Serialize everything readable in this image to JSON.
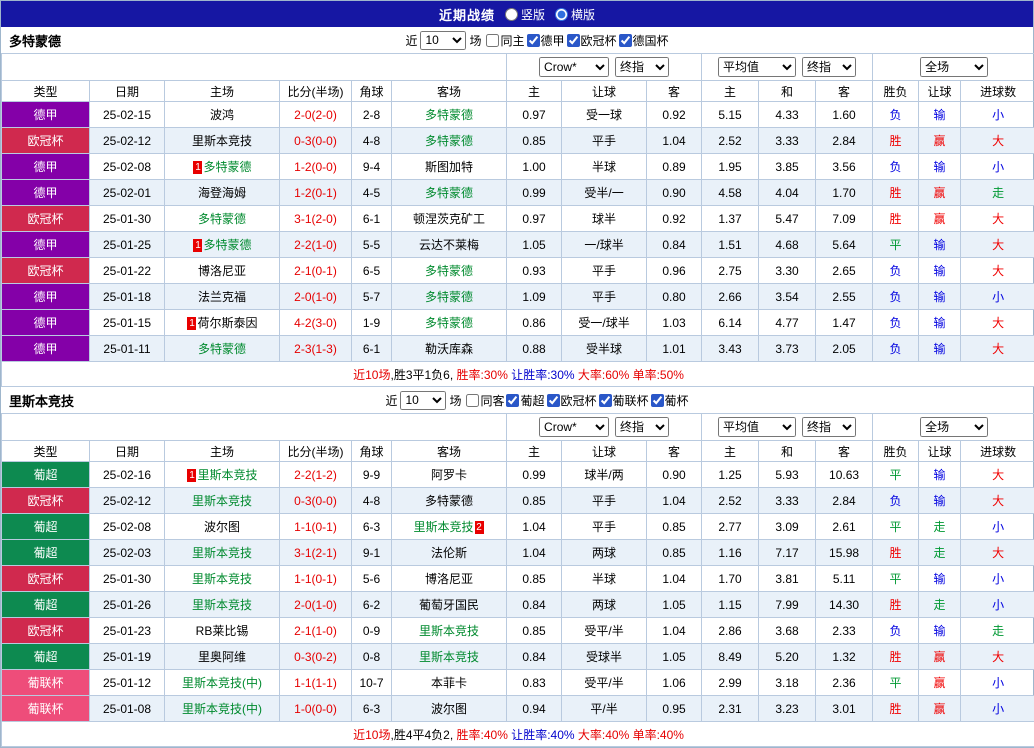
{
  "topbar": {
    "title": "近期战绩",
    "layout_options": [
      {
        "label": "竖版",
        "selected": false
      },
      {
        "label": "横版",
        "selected": true
      }
    ]
  },
  "table_head": {
    "selects": {
      "bookmaker": "Crow*",
      "ah_final": "终指",
      "eu_avg": "平均值",
      "eu_final": "终指",
      "scope": "全场"
    },
    "labels": [
      "类型",
      "日期",
      "主场",
      "比分(半场)",
      "角球",
      "客场",
      "主",
      "让球",
      "客",
      "主",
      "和",
      "客",
      "胜负",
      "让球",
      "进球数"
    ]
  },
  "league_colors": {
    "德甲": "#8400a8",
    "欧冠杯": "#d0294e",
    "葡超": "#0d8a50",
    "葡联杯": "#ee4d7a"
  },
  "sections": [
    {
      "team": "多特蒙德",
      "filter": {
        "near": "近",
        "count": "10",
        "unit": "场",
        "checkboxes": [
          {
            "label": "同主",
            "checked": false
          },
          {
            "label": "德甲",
            "checked": true
          },
          {
            "label": "欧冠杯",
            "checked": true
          },
          {
            "label": "德国杯",
            "checked": true
          }
        ]
      },
      "rows": [
        {
          "league": "德甲",
          "date": "25-02-15",
          "home": {
            "name": "波鸿"
          },
          "score": "2-0(2-0)",
          "corners": "2-8",
          "away": {
            "name": "多特蒙德",
            "tracked": true
          },
          "ah": [
            "0.97",
            "受一球",
            "0.92"
          ],
          "eu": [
            "5.15",
            "4.33",
            "1.60"
          ],
          "results": [
            [
              "负",
              "l"
            ],
            [
              "输",
              "l"
            ],
            [
              "小",
              "l"
            ]
          ]
        },
        {
          "league": "欧冠杯",
          "date": "25-02-12",
          "home": {
            "name": "里斯本竞技"
          },
          "score": "0-3(0-0)",
          "corners": "4-8",
          "away": {
            "name": "多特蒙德",
            "tracked": true
          },
          "ah": [
            "0.85",
            "平手",
            "1.04"
          ],
          "eu": [
            "2.52",
            "3.33",
            "2.84"
          ],
          "results": [
            [
              "胜",
              "w"
            ],
            [
              "赢",
              "w"
            ],
            [
              "大",
              "w"
            ]
          ]
        },
        {
          "league": "德甲",
          "date": "25-02-08",
          "home": {
            "name": "多特蒙德",
            "tracked": true,
            "badge": "1"
          },
          "score": "1-2(0-0)",
          "corners": "9-4",
          "away": {
            "name": "斯图加特"
          },
          "ah": [
            "1.00",
            "半球",
            "0.89"
          ],
          "eu": [
            "1.95",
            "3.85",
            "3.56"
          ],
          "results": [
            [
              "负",
              "l"
            ],
            [
              "输",
              "l"
            ],
            [
              "小",
              "l"
            ]
          ]
        },
        {
          "league": "德甲",
          "date": "25-02-01",
          "home": {
            "name": "海登海姆"
          },
          "score": "1-2(0-1)",
          "corners": "4-5",
          "away": {
            "name": "多特蒙德",
            "tracked": true
          },
          "ah": [
            "0.99",
            "受半/一",
            "0.90"
          ],
          "eu": [
            "4.58",
            "4.04",
            "1.70"
          ],
          "results": [
            [
              "胜",
              "w"
            ],
            [
              "赢",
              "w"
            ],
            [
              "走",
              "d"
            ]
          ]
        },
        {
          "league": "欧冠杯",
          "date": "25-01-30",
          "home": {
            "name": "多特蒙德",
            "tracked": true
          },
          "score": "3-1(2-0)",
          "corners": "6-1",
          "away": {
            "name": "顿涅茨克矿工"
          },
          "ah": [
            "0.97",
            "球半",
            "0.92"
          ],
          "eu": [
            "1.37",
            "5.47",
            "7.09"
          ],
          "results": [
            [
              "胜",
              "w"
            ],
            [
              "赢",
              "w"
            ],
            [
              "大",
              "w"
            ]
          ]
        },
        {
          "league": "德甲",
          "date": "25-01-25",
          "home": {
            "name": "多特蒙德",
            "tracked": true,
            "badge": "1"
          },
          "score": "2-2(1-0)",
          "corners": "5-5",
          "away": {
            "name": "云达不莱梅"
          },
          "ah": [
            "1.05",
            "一/球半",
            "0.84"
          ],
          "eu": [
            "1.51",
            "4.68",
            "5.64"
          ],
          "results": [
            [
              "平",
              "d"
            ],
            [
              "输",
              "l"
            ],
            [
              "大",
              "w"
            ]
          ]
        },
        {
          "league": "欧冠杯",
          "date": "25-01-22",
          "home": {
            "name": "博洛尼亚"
          },
          "score": "2-1(0-1)",
          "corners": "6-5",
          "away": {
            "name": "多特蒙德",
            "tracked": true
          },
          "ah": [
            "0.93",
            "平手",
            "0.96"
          ],
          "eu": [
            "2.75",
            "3.30",
            "2.65"
          ],
          "results": [
            [
              "负",
              "l"
            ],
            [
              "输",
              "l"
            ],
            [
              "大",
              "w"
            ]
          ]
        },
        {
          "league": "德甲",
          "date": "25-01-18",
          "home": {
            "name": "法兰克福"
          },
          "score": "2-0(1-0)",
          "corners": "5-7",
          "away": {
            "name": "多特蒙德",
            "tracked": true
          },
          "ah": [
            "1.09",
            "平手",
            "0.80"
          ],
          "eu": [
            "2.66",
            "3.54",
            "2.55"
          ],
          "results": [
            [
              "负",
              "l"
            ],
            [
              "输",
              "l"
            ],
            [
              "小",
              "l"
            ]
          ]
        },
        {
          "league": "德甲",
          "date": "25-01-15",
          "home": {
            "name": "荷尔斯泰因",
            "badge": "1"
          },
          "score": "4-2(3-0)",
          "corners": "1-9",
          "away": {
            "name": "多特蒙德",
            "tracked": true
          },
          "ah": [
            "0.86",
            "受一/球半",
            "1.03"
          ],
          "eu": [
            "6.14",
            "4.77",
            "1.47"
          ],
          "results": [
            [
              "负",
              "l"
            ],
            [
              "输",
              "l"
            ],
            [
              "大",
              "w"
            ]
          ]
        },
        {
          "league": "德甲",
          "date": "25-01-11",
          "home": {
            "name": "多特蒙德",
            "tracked": true
          },
          "score": "2-3(1-3)",
          "corners": "6-1",
          "away": {
            "name": "勒沃库森"
          },
          "ah": [
            "0.88",
            "受半球",
            "1.01"
          ],
          "eu": [
            "3.43",
            "3.73",
            "2.05"
          ],
          "results": [
            [
              "负",
              "l"
            ],
            [
              "输",
              "l"
            ],
            [
              "大",
              "w"
            ]
          ]
        }
      ],
      "summary": [
        {
          "text": "近10场",
          "cls": "red"
        },
        {
          "text": ",胜3平1负6, ",
          "cls": "black"
        },
        {
          "text": "胜率:30%",
          "cls": "red"
        },
        {
          "text": " 让胜率:30%",
          "cls": "blue"
        },
        {
          "text": " 大率:60%",
          "cls": "red"
        },
        {
          "text": " 单率:50%",
          "cls": "red"
        }
      ]
    },
    {
      "team": "里斯本竞技",
      "filter": {
        "near": "近",
        "count": "10",
        "unit": "场",
        "checkboxes": [
          {
            "label": "同客",
            "checked": false
          },
          {
            "label": "葡超",
            "checked": true
          },
          {
            "label": "欧冠杯",
            "checked": true
          },
          {
            "label": "葡联杯",
            "checked": true
          },
          {
            "label": "葡杯",
            "checked": true
          }
        ]
      },
      "rows": [
        {
          "league": "葡超",
          "date": "25-02-16",
          "home": {
            "name": "里斯本竞技",
            "tracked": true,
            "badge": "1"
          },
          "score": "2-2(1-2)",
          "corners": "9-9",
          "away": {
            "name": "阿罗卡"
          },
          "ah": [
            "0.99",
            "球半/两",
            "0.90"
          ],
          "eu": [
            "1.25",
            "5.93",
            "10.63"
          ],
          "results": [
            [
              "平",
              "d"
            ],
            [
              "输",
              "l"
            ],
            [
              "大",
              "w"
            ]
          ]
        },
        {
          "league": "欧冠杯",
          "date": "25-02-12",
          "home": {
            "name": "里斯本竞技",
            "tracked": true
          },
          "score": "0-3(0-0)",
          "corners": "4-8",
          "away": {
            "name": "多特蒙德"
          },
          "ah": [
            "0.85",
            "平手",
            "1.04"
          ],
          "eu": [
            "2.52",
            "3.33",
            "2.84"
          ],
          "results": [
            [
              "负",
              "l"
            ],
            [
              "输",
              "l"
            ],
            [
              "大",
              "w"
            ]
          ]
        },
        {
          "league": "葡超",
          "date": "25-02-08",
          "home": {
            "name": "波尔图"
          },
          "score": "1-1(0-1)",
          "corners": "6-3",
          "away": {
            "name": "里斯本竞技",
            "tracked": true,
            "badge": "2"
          },
          "ah": [
            "1.04",
            "平手",
            "0.85"
          ],
          "eu": [
            "2.77",
            "3.09",
            "2.61"
          ],
          "results": [
            [
              "平",
              "d"
            ],
            [
              "走",
              "d"
            ],
            [
              "小",
              "l"
            ]
          ]
        },
        {
          "league": "葡超",
          "date": "25-02-03",
          "home": {
            "name": "里斯本竞技",
            "tracked": true
          },
          "score": "3-1(2-1)",
          "corners": "9-1",
          "away": {
            "name": "法伦斯"
          },
          "ah": [
            "1.04",
            "两球",
            "0.85"
          ],
          "eu": [
            "1.16",
            "7.17",
            "15.98"
          ],
          "results": [
            [
              "胜",
              "w"
            ],
            [
              "走",
              "d"
            ],
            [
              "大",
              "w"
            ]
          ]
        },
        {
          "league": "欧冠杯",
          "date": "25-01-30",
          "home": {
            "name": "里斯本竞技",
            "tracked": true
          },
          "score": "1-1(0-1)",
          "corners": "5-6",
          "away": {
            "name": "博洛尼亚"
          },
          "ah": [
            "0.85",
            "半球",
            "1.04"
          ],
          "eu": [
            "1.70",
            "3.81",
            "5.11"
          ],
          "results": [
            [
              "平",
              "d"
            ],
            [
              "输",
              "l"
            ],
            [
              "小",
              "l"
            ]
          ]
        },
        {
          "league": "葡超",
          "date": "25-01-26",
          "home": {
            "name": "里斯本竞技",
            "tracked": true
          },
          "score": "2-0(1-0)",
          "corners": "6-2",
          "away": {
            "name": "葡萄牙国民"
          },
          "ah": [
            "0.84",
            "两球",
            "1.05"
          ],
          "eu": [
            "1.15",
            "7.99",
            "14.30"
          ],
          "results": [
            [
              "胜",
              "w"
            ],
            [
              "走",
              "d"
            ],
            [
              "小",
              "l"
            ]
          ]
        },
        {
          "league": "欧冠杯",
          "date": "25-01-23",
          "home": {
            "name": "RB莱比锡"
          },
          "score": "2-1(1-0)",
          "corners": "0-9",
          "away": {
            "name": "里斯本竞技",
            "tracked": true
          },
          "ah": [
            "0.85",
            "受平/半",
            "1.04"
          ],
          "eu": [
            "2.86",
            "3.68",
            "2.33"
          ],
          "results": [
            [
              "负",
              "l"
            ],
            [
              "输",
              "l"
            ],
            [
              "走",
              "d"
            ]
          ]
        },
        {
          "league": "葡超",
          "date": "25-01-19",
          "home": {
            "name": "里奥阿维"
          },
          "score": "0-3(0-2)",
          "corners": "0-8",
          "away": {
            "name": "里斯本竞技",
            "tracked": true
          },
          "ah": [
            "0.84",
            "受球半",
            "1.05"
          ],
          "eu": [
            "8.49",
            "5.20",
            "1.32"
          ],
          "results": [
            [
              "胜",
              "w"
            ],
            [
              "赢",
              "w"
            ],
            [
              "大",
              "w"
            ]
          ]
        },
        {
          "league": "葡联杯",
          "date": "25-01-12",
          "home": {
            "name": "里斯本竞技(中)",
            "tracked": true
          },
          "score": "1-1(1-1)",
          "corners": "10-7",
          "away": {
            "name": "本菲卡"
          },
          "ah": [
            "0.83",
            "受平/半",
            "1.06"
          ],
          "eu": [
            "2.99",
            "3.18",
            "2.36"
          ],
          "results": [
            [
              "平",
              "d"
            ],
            [
              "赢",
              "w"
            ],
            [
              "小",
              "l"
            ]
          ]
        },
        {
          "league": "葡联杯",
          "date": "25-01-08",
          "home": {
            "name": "里斯本竞技(中)",
            "tracked": true
          },
          "score": "1-0(0-0)",
          "corners": "6-3",
          "away": {
            "name": "波尔图"
          },
          "ah": [
            "0.94",
            "平/半",
            "0.95"
          ],
          "eu": [
            "2.31",
            "3.23",
            "3.01"
          ],
          "results": [
            [
              "胜",
              "w"
            ],
            [
              "赢",
              "w"
            ],
            [
              "小",
              "l"
            ]
          ]
        }
      ],
      "summary": [
        {
          "text": "近10场",
          "cls": "red"
        },
        {
          "text": ",胜4平4负2, ",
          "cls": "black"
        },
        {
          "text": "胜率:40%",
          "cls": "red"
        },
        {
          "text": " 让胜率:40%",
          "cls": "blue"
        },
        {
          "text": " 大率:40%",
          "cls": "red"
        },
        {
          "text": " 单率:40%",
          "cls": "red"
        }
      ]
    }
  ]
}
